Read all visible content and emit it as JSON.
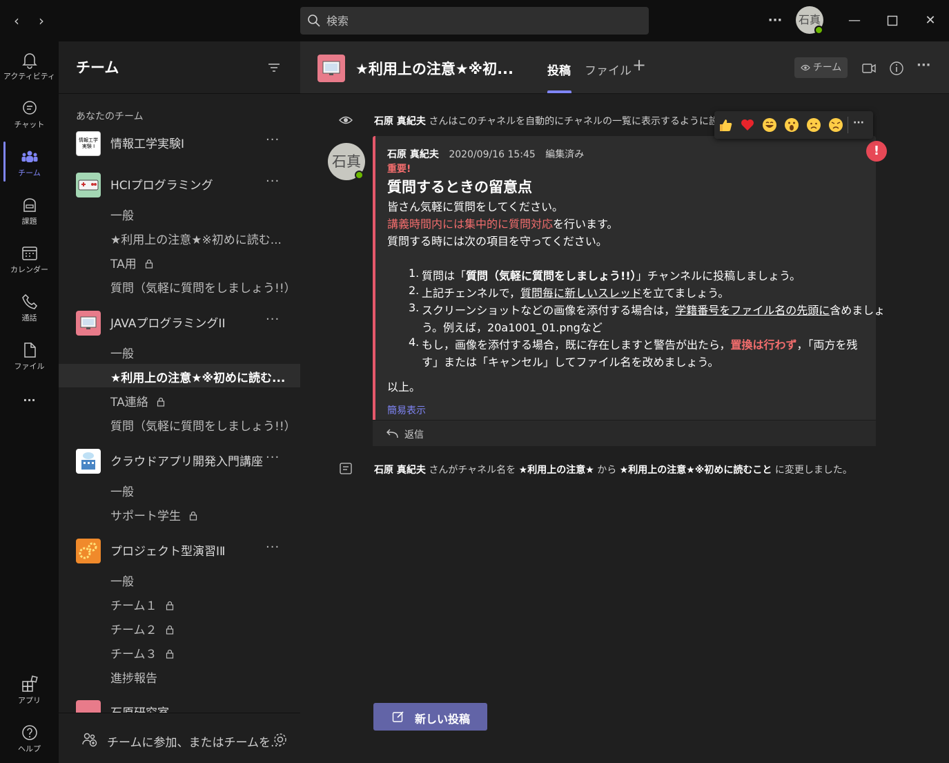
{
  "titlebar": {
    "back_glyph": "‹",
    "forward_glyph": "›",
    "search_placeholder": "検索",
    "more_glyph": "···",
    "user_initials": "石真",
    "minimize_glyph": "—",
    "close_glyph": "✕"
  },
  "rail": [
    {
      "label": "アクティビティ",
      "icon": "bell-icon"
    },
    {
      "label": "チャット",
      "icon": "chat-icon"
    },
    {
      "label": "チーム",
      "icon": "teams-icon"
    },
    {
      "label": "課題",
      "icon": "assignments-icon"
    },
    {
      "label": "カレンダー",
      "icon": "calendar-icon"
    },
    {
      "label": "通話",
      "icon": "phone-icon"
    },
    {
      "label": "ファイル",
      "icon": "file-icon"
    }
  ],
  "rail_more": "···",
  "rail_bottom": [
    {
      "label": "アプリ",
      "icon": "apps-icon"
    },
    {
      "label": "ヘルプ",
      "icon": "help-icon"
    }
  ],
  "teampanel": {
    "title": "チーム",
    "section_label": "あなたのチーム",
    "more_glyph": "···",
    "teams": [
      {
        "name": "情報工学実験I",
        "thumb_text": "情報工学 実験 I"
      },
      {
        "name": "HCIプログラミング"
      },
      {
        "name": "JAVAプログラミングII"
      },
      {
        "name": "クラウドアプリ開発入門講座"
      },
      {
        "name": "プロジェクト型演習ⅠⅡ"
      },
      {
        "name": "石原研究室"
      }
    ],
    "channels": [
      {
        "name": "一般"
      },
      {
        "name": "★利用上の注意★※初めに読む..."
      },
      {
        "name": "TA用"
      },
      {
        "name": "質問（気軽に質問をしましょう!!）"
      },
      {
        "name": "一般"
      },
      {
        "name": "★利用上の注意★※初めに読む..."
      },
      {
        "name": "TA連絡"
      },
      {
        "name": "質問（気軽に質問をしましょう!!）"
      },
      {
        "name": "一般"
      },
      {
        "name": "サポート学生"
      },
      {
        "name": "一般"
      },
      {
        "name": "チーム１"
      },
      {
        "name": "チーム２"
      },
      {
        "name": "チーム３"
      },
      {
        "name": "進捗報告"
      }
    ],
    "join_label": "チームに参加、またはチームを..."
  },
  "channel_header": {
    "title": "★利用上の注意★※初...",
    "tabs": [
      "投稿",
      "ファイル"
    ],
    "add_tab": "+",
    "team_chip": "チーム",
    "more_glyph": "···"
  },
  "feed": {
    "sys1_name": "石原 真紀夫",
    "sys1_text": " さんはこのチャネルを自動的にチャネルの一覧に表示するように設定しま",
    "message": {
      "author": "石原 真紀夫",
      "initials": "石真",
      "timestamp": "2020/09/16 15:45",
      "edited": "編集済み",
      "important": "重要!",
      "subject": "質問するときの留意点",
      "line1": "皆さん気軽に質問をしてください。",
      "line2_red": "講義時間内には集中的に質問対応",
      "line2_rest": "を行います。",
      "line3": "質問する時には次の項目を守ってください。",
      "items": {
        "n1": "1.",
        "i1_a": "質問は「",
        "i1_b": "質問（気軽に質問をしましょう!!）",
        "i1_c": "」チャンネルに投稿しましょう。",
        "n2": "2.",
        "i2_a": "上記チェンネルで，",
        "i2_b": "質問毎に新しいスレッド",
        "i2_c": "を立てましょう。",
        "n3": "3.",
        "i3_a": "スクリーンショットなどの画像を添付する場合は，",
        "i3_b": "学籍番号をファイル名の先頭に",
        "i3_c": "含めましょ",
        "i3_d": "う。例えば，20a1001_01.pngなど",
        "n4": "4.",
        "i4_a": "もし，画像を添付する場合，既に存在しますと警告が出たら，",
        "i4_b": "置換は行わず",
        "i4_c": "，「両方を残",
        "i4_d": "す」または「キャンセル」してファイル名を改めましょう。"
      },
      "closing": "以上。",
      "collapse": "簡易表示",
      "reply": "返信",
      "important_badge": "!"
    },
    "reactions": [
      "like",
      "heart",
      "laugh",
      "surprised",
      "sad",
      "angry"
    ],
    "reactions_more": "···",
    "sys2": {
      "name": "石原 真紀夫",
      "mid1": " さんがチャネル名を ",
      "old": "★利用上の注意★",
      "mid2": " から ",
      "new": "★利用上の注意★※初めに読むこと",
      "end": " に変更しました。"
    },
    "new_post": "新しい投稿"
  },
  "colors": {
    "accent": "#7f85f5",
    "button": "#6264a7",
    "important": "#e5586b",
    "presence": "#6bb700"
  }
}
